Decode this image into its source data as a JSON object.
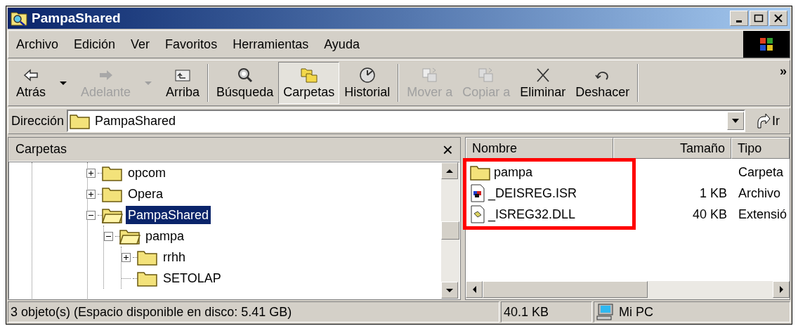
{
  "window": {
    "title": "PampaShared"
  },
  "menu": [
    "Archivo",
    "Edición",
    "Ver",
    "Favoritos",
    "Herramientas",
    "Ayuda"
  ],
  "toolbar": [
    {
      "kind": "button",
      "label": "Atrás",
      "disabled": false,
      "selected": false,
      "dropdown": true
    },
    {
      "kind": "button",
      "label": "Adelante",
      "disabled": true,
      "selected": false,
      "dropdown": true
    },
    {
      "kind": "button",
      "label": "Arriba",
      "disabled": false,
      "selected": false,
      "dropdown": false
    },
    {
      "kind": "separator"
    },
    {
      "kind": "button",
      "label": "Búsqueda",
      "disabled": false,
      "selected": false,
      "dropdown": false
    },
    {
      "kind": "button",
      "label": "Carpetas",
      "disabled": false,
      "selected": true,
      "dropdown": false
    },
    {
      "kind": "button",
      "label": "Historial",
      "disabled": false,
      "selected": false,
      "dropdown": false
    },
    {
      "kind": "separator"
    },
    {
      "kind": "button",
      "label": "Mover a",
      "disabled": true,
      "selected": false,
      "dropdown": false
    },
    {
      "kind": "button",
      "label": "Copiar a",
      "disabled": true,
      "selected": false,
      "dropdown": false
    },
    {
      "kind": "button",
      "label": "Eliminar",
      "disabled": false,
      "selected": false,
      "dropdown": false
    },
    {
      "kind": "button",
      "label": "Deshacer",
      "disabled": false,
      "selected": false,
      "dropdown": false
    },
    {
      "kind": "separator"
    }
  ],
  "toolbar_more": "»",
  "address": {
    "label": "Dirección",
    "value": "PampaShared",
    "go": "Ir"
  },
  "folders_pane": {
    "title": "Carpetas",
    "close": "×",
    "tree": [
      {
        "label": "opcom",
        "kind": "branch",
        "expanded": false,
        "selected": false
      },
      {
        "label": "Opera",
        "kind": "branch",
        "expanded": false,
        "selected": false
      },
      {
        "label": "PampaShared",
        "kind": "branch",
        "expanded": true,
        "selected": true,
        "children": [
          {
            "label": "pampa",
            "kind": "branch",
            "expanded": true,
            "selected": false,
            "children": [
              {
                "label": "rrhh",
                "kind": "branch",
                "expanded": false,
                "selected": false
              },
              {
                "label": "SETOLAP",
                "kind": "leaf",
                "selected": false
              }
            ]
          }
        ]
      }
    ]
  },
  "file_list": {
    "columns": [
      "Nombre",
      "Tamaño",
      "Tipo"
    ],
    "rows": [
      {
        "kind": "folder",
        "name": "pampa",
        "type": "Carpeta"
      },
      {
        "kind": "isr",
        "name": "_DEISREG.ISR",
        "size": "1 KB",
        "type": "Archivo"
      },
      {
        "kind": "dll",
        "name": "_ISREG32.DLL",
        "size": "40 KB",
        "type": "Extensió"
      }
    ]
  },
  "status_bar": {
    "objects": "3 objeto(s) (Espacio disponible en disco:  5.41 GB)",
    "size": "40.1 KB",
    "zone": "Mi PC"
  }
}
